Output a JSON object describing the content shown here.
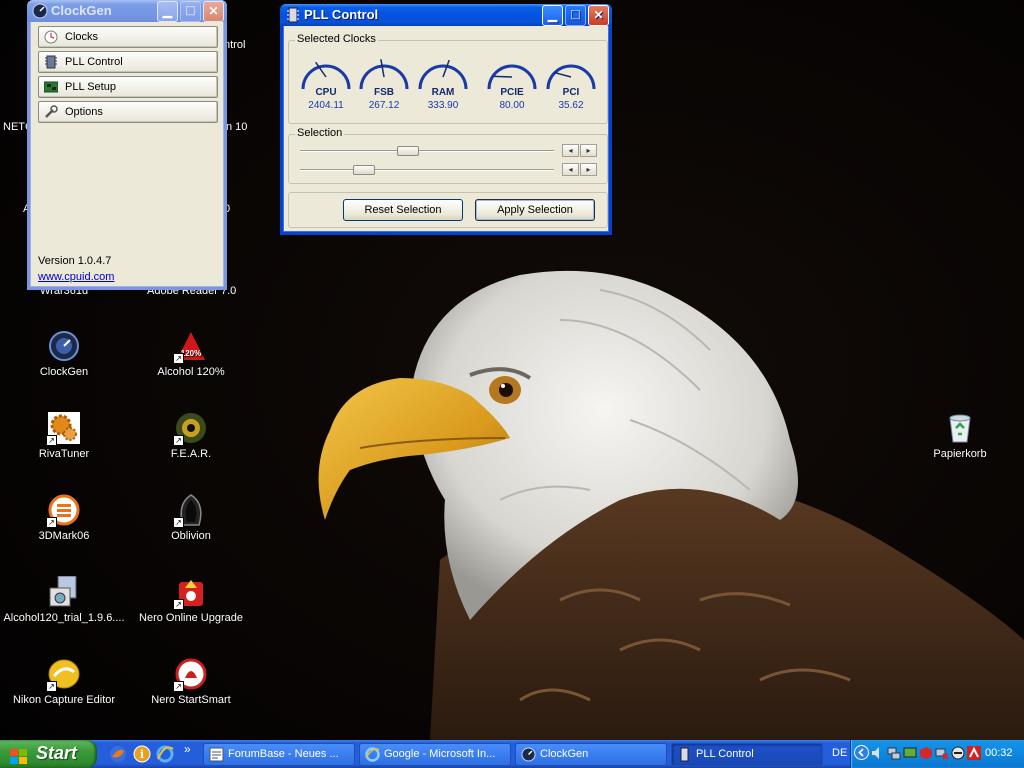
{
  "desktop": {
    "icons_partial": [
      "NETG",
      "A"
    ],
    "hidden_labels": [
      "ntrol",
      "n 10",
      "0",
      "Wrar361d",
      "Adobe Reader 7.0"
    ],
    "icons": [
      {
        "label": "ClockGen",
        "icon": "clockgen-icon"
      },
      {
        "label": "Alcohol 120%",
        "icon": "alcohol-icon"
      },
      {
        "label": "RivaTuner",
        "icon": "rivatuner-icon"
      },
      {
        "label": "F.E.A.R.",
        "icon": "fear-icon"
      },
      {
        "label": "3DMark06",
        "icon": "3dmark-icon"
      },
      {
        "label": "Oblivion",
        "icon": "oblivion-icon"
      },
      {
        "label": "Alcohol120_trial_1.9.6....",
        "icon": "installer-icon"
      },
      {
        "label": "Nero Online Upgrade",
        "icon": "nero-upgrade-icon"
      },
      {
        "label": "Nikon Capture Editor",
        "icon": "nikon-icon"
      },
      {
        "label": "Nero StartSmart",
        "icon": "nero-startsmart-icon"
      },
      {
        "label": "Papierkorb",
        "icon": "recycle-bin-icon"
      }
    ]
  },
  "clockgen_window": {
    "title": "ClockGen",
    "buttons": [
      {
        "label": "Clocks",
        "icon": "clock-icon"
      },
      {
        "label": "PLL Control",
        "icon": "pll-chip-icon"
      },
      {
        "label": "PLL Setup",
        "icon": "circuit-board-icon"
      },
      {
        "label": "Options",
        "icon": "wrench-icon"
      }
    ],
    "version": "Version 1.0.4.7",
    "link": "www.cpuid.com"
  },
  "pll_window": {
    "title": "PLL Control",
    "selected_clocks_label": "Selected Clocks",
    "gauges": [
      {
        "name": "CPU",
        "value": "2404.11"
      },
      {
        "name": "FSB",
        "value": "267.12"
      },
      {
        "name": "RAM",
        "value": "333.90"
      },
      {
        "name": "PCIE",
        "value": "80.00"
      },
      {
        "name": "PCI",
        "value": "35.62"
      }
    ],
    "selection_label": "Selection",
    "sliders": [
      {
        "position": 0.42
      },
      {
        "position": 0.23
      }
    ],
    "reset_label": "Reset Selection",
    "apply_label": "Apply Selection"
  },
  "taskbar": {
    "start_label": "Start",
    "quick_launch": [
      "firefox-icon",
      "info-icon",
      "ie-icon"
    ],
    "overflow": "»",
    "tasks": [
      {
        "label": "ForumBase - Neues ...",
        "icon": "firefox-icon"
      },
      {
        "label": "Google - Microsoft In...",
        "icon": "ie-icon"
      },
      {
        "label": "ClockGen",
        "icon": "clockgen-icon"
      },
      {
        "label": "PLL Control",
        "icon": "pll-chip-icon"
      }
    ],
    "language": "DE",
    "clock": "00:32"
  },
  "colors": {
    "xp_blue": "#0553e1",
    "window_face": "#ece9d8",
    "gauge_blue": "#1a3aa8",
    "taskbar_blue": "#245edb",
    "start_green": "#3b9a3b"
  }
}
